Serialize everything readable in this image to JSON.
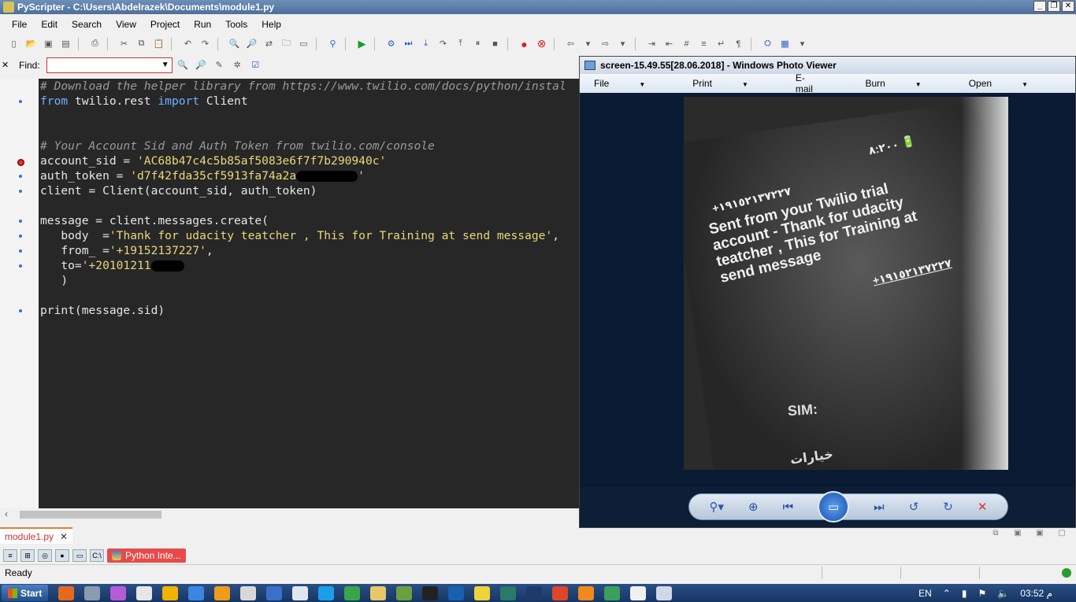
{
  "titlebar": {
    "title": "PyScripter - C:\\Users\\Abdelrazek\\Documents\\module1.py"
  },
  "menu": [
    "File",
    "Edit",
    "Search",
    "View",
    "Project",
    "Run",
    "Tools",
    "Help"
  ],
  "find": {
    "label": "Find:",
    "value": ""
  },
  "code_lines": [
    {
      "type": "comment",
      "text": "# Download the helper library from https://www.twilio.com/docs/python/instal"
    },
    {
      "type": "import",
      "kw1": "from",
      "mod": " twilio.rest ",
      "kw2": "import",
      "name": " Client"
    },
    {
      "type": "blank"
    },
    {
      "type": "blank"
    },
    {
      "type": "comment",
      "text": "# Your Account Sid and Auth Token from twilio.com/console"
    },
    {
      "type": "assign",
      "name": "account_sid = ",
      "str": "'AC68b47c4c5b85af5083e6f7f7b290940c'"
    },
    {
      "type": "assign_redacted",
      "name": "auth_token = ",
      "str": "'d7f42fda35cf5913fa74a2a",
      "tail": "'"
    },
    {
      "type": "plain",
      "text": "client = Client(account_sid, auth_token)"
    },
    {
      "type": "blank"
    },
    {
      "type": "plain",
      "text": "message = client.messages.create("
    },
    {
      "type": "assign",
      "name": "   body  =",
      "str": "'Thank for udacity teatcher , This for Training at send message'",
      "tail": ","
    },
    {
      "type": "assign",
      "name": "   from_ =",
      "str": "'+19152137227'",
      "tail": ","
    },
    {
      "type": "assign_redacted",
      "name": "   to=",
      "str": "'+20101211",
      "tail": ""
    },
    {
      "type": "plain",
      "text": "   )"
    },
    {
      "type": "blank"
    },
    {
      "type": "plain",
      "text": "print(message.sid)"
    }
  ],
  "tab": {
    "label": "module1.py",
    "close": "✕"
  },
  "python_interpreter": {
    "label": "Python Inte..."
  },
  "status": {
    "text": "Ready"
  },
  "viewer": {
    "title": "screen-15.49.55[28.06.2018] - Windows Photo Viewer",
    "menu": [
      "File",
      "Print",
      "E-mail",
      "Burn",
      "Open"
    ],
    "photo": {
      "top_status": "٨:٢٠٠ 🔋",
      "number": "+١٩١٥٢١٣٧٢٢٧",
      "message": "Sent from your Twilio trial account - Thank for udacity teatcher , This for Training at send message",
      "number_bottom": "+١٩١٥٢١٣٧٢٢٧",
      "sim": "SIM:",
      "arabic": "خيارات"
    }
  },
  "taskbar": {
    "start": "Start",
    "lang": "EN",
    "clock": "03:52 م"
  }
}
